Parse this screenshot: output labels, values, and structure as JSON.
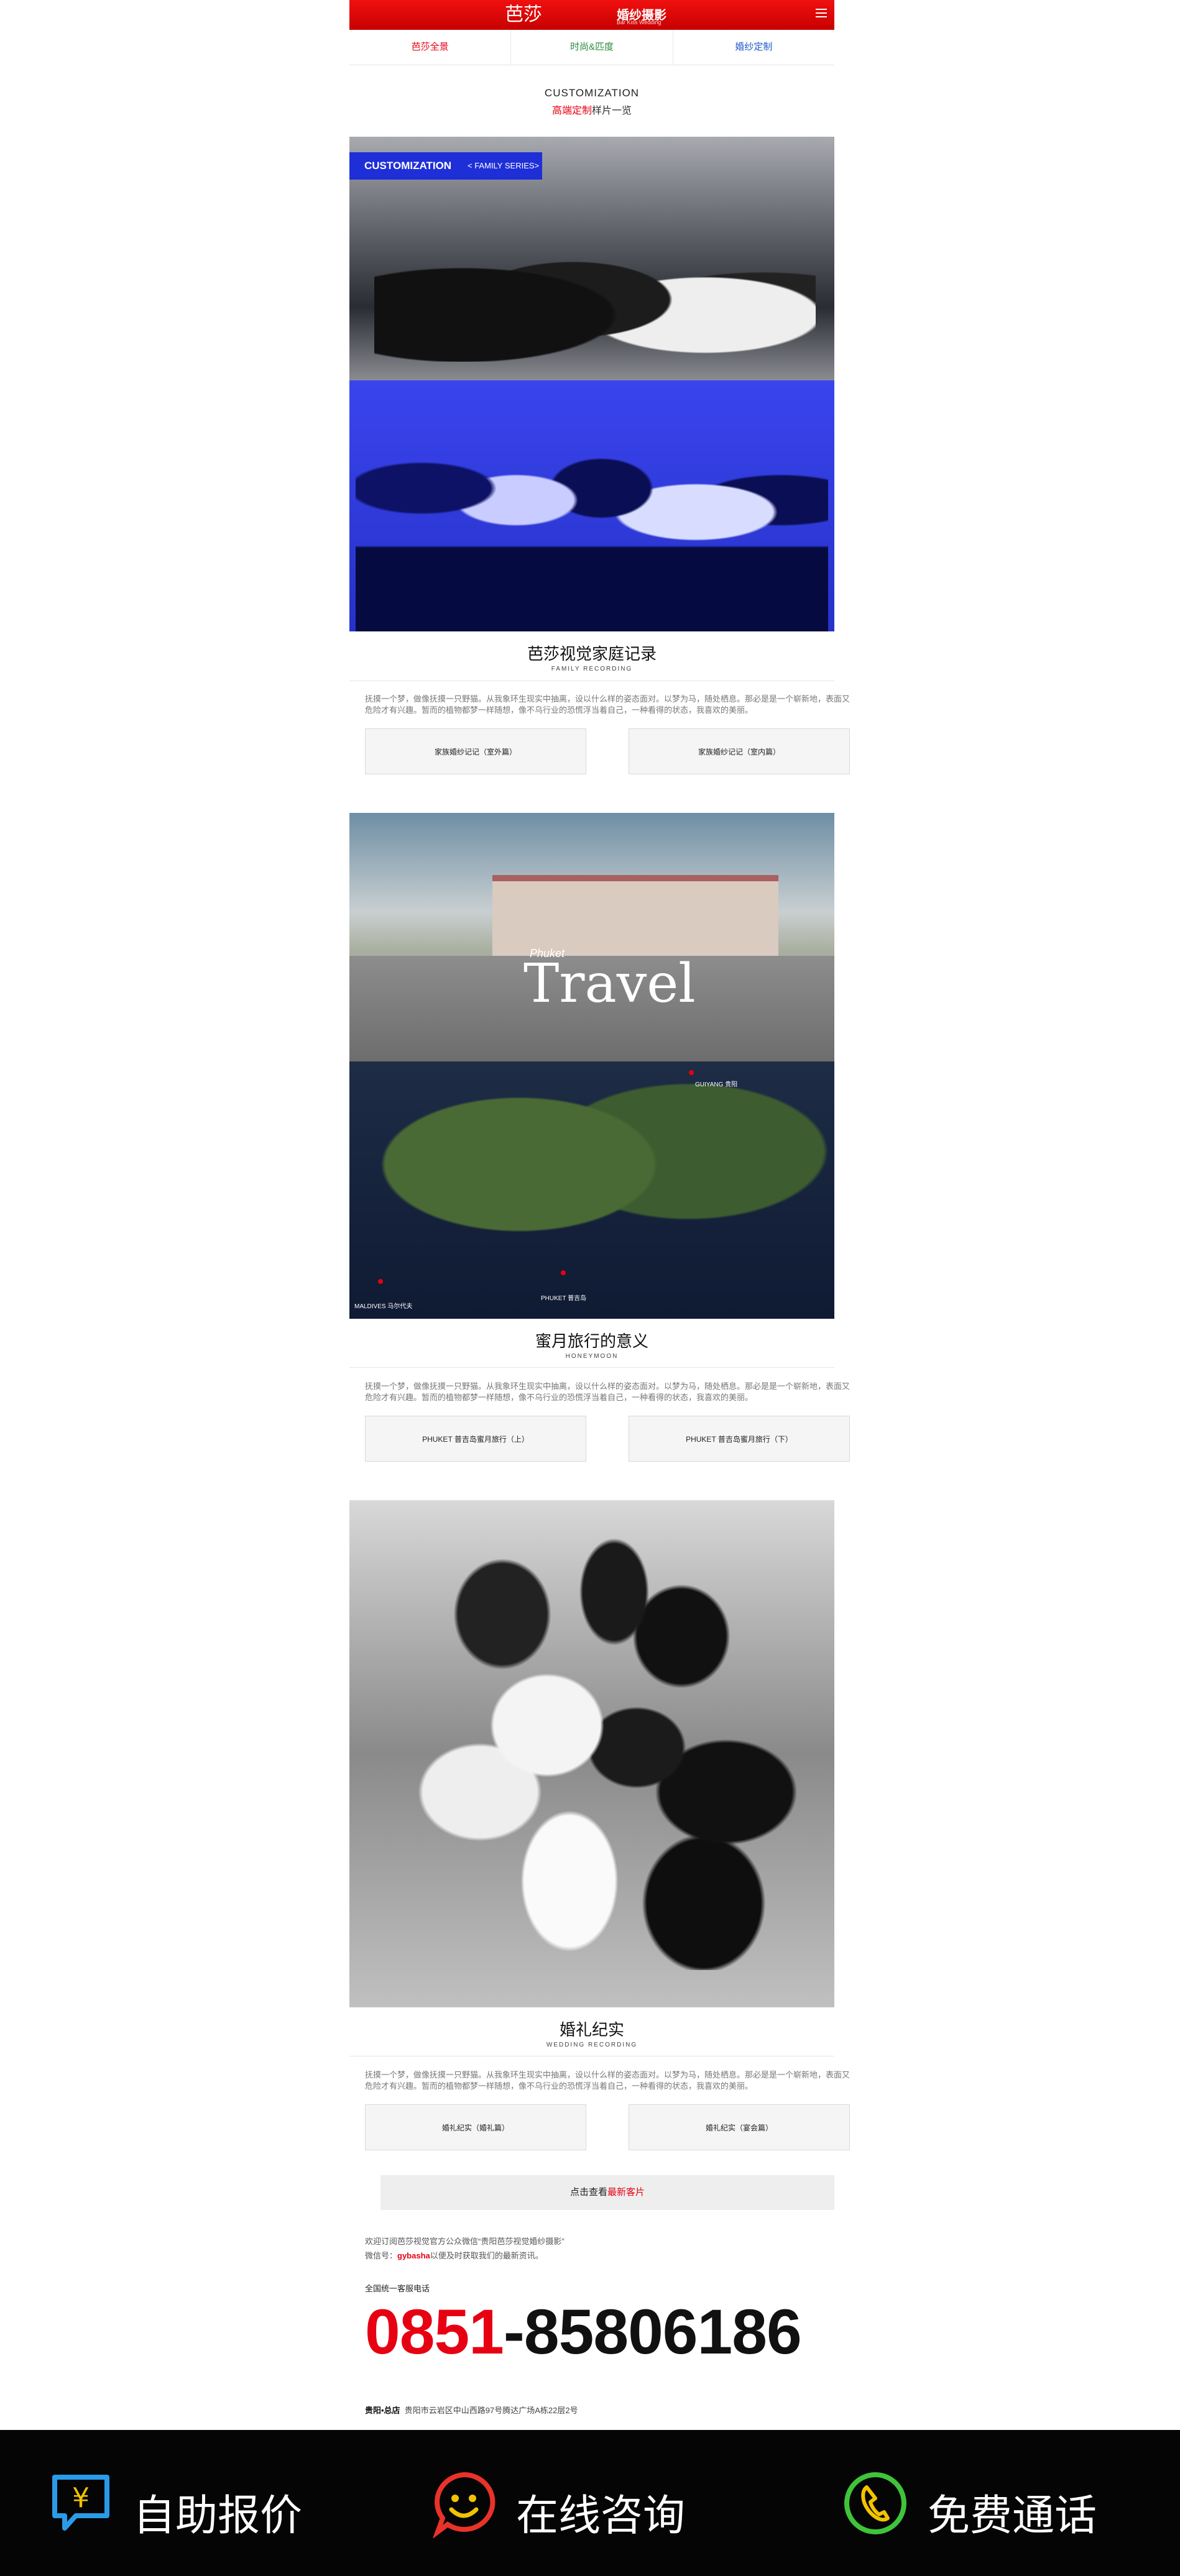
{
  "header": {
    "brand_mark": "芭莎",
    "brand_name": "婚纱摄影",
    "brand_sub": "Bar Kiss Wedding"
  },
  "tabs": [
    {
      "label": "芭莎全景",
      "color": "#e60012"
    },
    {
      "label": "时尚&匹度",
      "color": "#2a8a3a"
    },
    {
      "label": "婚纱定制",
      "color": "#1f58c8"
    }
  ],
  "page_head": {
    "en": "CUSTOMIZATION",
    "cn_red": "高端定制",
    "cn_rest": "样片一览"
  },
  "family_tag": {
    "big": "CUSTOMIZATION",
    "small": "< FAMILY SERIES>"
  },
  "sections": [
    {
      "title": "芭莎视觉家庭记录",
      "subtitle": "FAMILY RECORDING",
      "description": "抚摸一个梦，做像抚摸一只野猫。从我象环生现实中抽离，设以什么样的姿态面对。以梦为马，随处栖息。那必是是一个崭新地，表面又危险才有兴趣。暂而的植物都梦一样随想，像不乌行业的恐慌浮当着自己，一种看得的状态，我喜欢的美丽。",
      "buttons": [
        "家族婚纱记记（室外篇）",
        "家族婚纱记记（室内篇）"
      ]
    },
    {
      "title": "蜜月旅行的意义",
      "subtitle": "HONEYMOON",
      "description": "抚摸一个梦，做像抚摸一只野猫。从我象环生现实中抽离，设以什么样的姿态面对。以梦为马，随处栖息。那必是是一个崭新地，表面又危险才有兴趣。暂而的植物都梦一样随想，像不乌行业的恐慌浮当着自己，一种看得的状态，我喜欢的美丽。",
      "buttons": [
        "PHUKET 普吉岛蜜月旅行（上）",
        "PHUKET 普吉岛蜜月旅行（下）"
      ]
    },
    {
      "title": "婚礼纪实",
      "subtitle": "WEDDING RECORDING",
      "description": "抚摸一个梦，做像抚摸一只野猫。从我象环生现实中抽离，设以什么样的姿态面对。以梦为马，随处栖息。那必是是一个崭新地，表面又危险才有兴趣。暂而的植物都梦一样随想，像不乌行业的恐慌浮当着自己，一种看得的状态，我喜欢的美丽。",
      "buttons": [
        "婚礼纪实（婚礼篇）",
        "婚礼纪实（宴会篇）"
      ]
    }
  ],
  "travel_photo": {
    "small": "Phuket",
    "word": "Travel"
  },
  "map_labels": {
    "a": "MALDIVES 马尔代夫",
    "b": "PHUKET 普吉岛",
    "c": "GUIYANG 贵阳"
  },
  "more_button": {
    "prefix": "点击查看",
    "red": "最新客片"
  },
  "info": {
    "line1": "欢迎订阅芭莎视觉官方公众微信“贵阳芭莎视觉婚纱摄影”",
    "line2_prefix": "微信号：",
    "wechat_id": "gybasha",
    "line2_suffix": "以便及时获取我们的最新资讯。"
  },
  "hotline": {
    "label": "全国统一客服电话",
    "area": "0851",
    "number": "-85806186"
  },
  "address": {
    "store": "贵阳•总店",
    "text": "贵阳市云岩区中山西路97号腾达广场A栋22层2号"
  },
  "bottom_bar": [
    {
      "label": "自助报价",
      "icon": "yuan-chat-icon",
      "glyph": "¥",
      "color": "#2a9be8"
    },
    {
      "label": "在线咨询",
      "icon": "smile-chat-icon",
      "glyph": "☺",
      "color": "#e8322a"
    },
    {
      "label": "免费通话",
      "icon": "phone-icon",
      "glyph": "✆",
      "color": "#3ec43a"
    }
  ]
}
